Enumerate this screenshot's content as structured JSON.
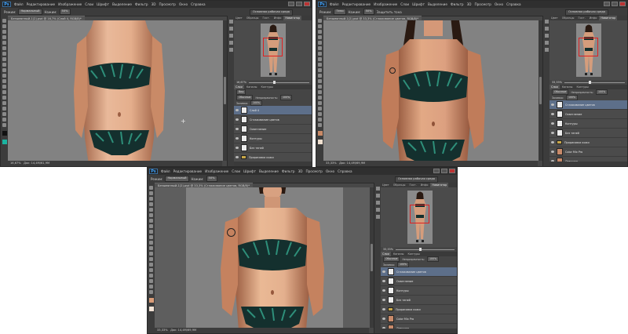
{
  "app_logo": "Ps",
  "menu_items": [
    "Файл",
    "Редактирование",
    "Изображение",
    "Слои",
    "Шрифт",
    "Выделение",
    "Фильтр",
    "3D",
    "Просмотр",
    "Окно",
    "Справка"
  ],
  "options": {
    "mode_label": "Режим:",
    "mode_value": "Нормальный",
    "opacity_label": "Нажим:",
    "opacity_value": "50%",
    "protect_label": "Защитить тона",
    "workspace": "Основная рабочая среда",
    "win2_mode_value": "Тени"
  },
  "windows": [
    {
      "doc_title": "Безымянный-1(2).psd @ 16,7% (Слой 4, RGB/8)*",
      "status": "16,67%",
      "doc_info": "Док: 14,4M/61,9M",
      "layer_mode": "Обычные",
      "opacity_label": "Непрозрачность:",
      "opacity": "100%",
      "fill_label": "Заливка:",
      "fill": "100%",
      "kind_label": "Вид",
      "layers": [
        {
          "name": "Слой 4",
          "type": "layer",
          "selected": true
        },
        {
          "name": "Сглаживание цветов",
          "type": "layer",
          "selected": false
        },
        {
          "name": "Осветление",
          "type": "layer",
          "selected": false
        },
        {
          "name": "Контуры",
          "type": "layer",
          "selected": false
        },
        {
          "name": "Без теней",
          "type": "layer",
          "selected": false
        },
        {
          "name": "Прорисовка кожи",
          "type": "group",
          "selected": false
        },
        {
          "name": "Color Mix Pro",
          "type": "skin",
          "selected": false
        }
      ]
    },
    {
      "doc_title": "Безымянный-1(2).psd @ 33,3% (Сглаживание цветов, RGB/8)*",
      "status": "33,33%",
      "doc_info": "Док: 14,4M/69,9M",
      "layer_mode": "Обычные",
      "opacity_label": "Непрозрачность:",
      "opacity": "100%",
      "fill_label": "Заливка:",
      "fill": "100%",
      "kind_label": "Вид",
      "layers": [
        {
          "name": "Сглаживание цветов",
          "type": "layer",
          "selected": true
        },
        {
          "name": "Осветление",
          "type": "layer",
          "selected": false
        },
        {
          "name": "Контуры",
          "type": "layer",
          "selected": false
        },
        {
          "name": "Без теней",
          "type": "layer",
          "selected": false
        },
        {
          "name": "Прорисовка кожи",
          "type": "group",
          "selected": false
        },
        {
          "name": "Color Mix Pro",
          "type": "skin",
          "selected": false
        },
        {
          "name": "Девушка",
          "type": "skin",
          "selected": false
        }
      ]
    },
    {
      "doc_title": "Безымянный-1(2).psd @ 33,3% (Сглаживание цветов, RGB/8)*",
      "status": "33,33%",
      "doc_info": "Док: 14,4M/69,9M",
      "layer_mode": "Обычные",
      "opacity_label": "Непрозрачность:",
      "opacity": "100%",
      "fill_label": "Заливка:",
      "fill": "100%",
      "kind_label": "Вид",
      "layers": [
        {
          "name": "Сглаживание цветов",
          "type": "layer",
          "selected": true
        },
        {
          "name": "Осветление",
          "type": "layer",
          "selected": false
        },
        {
          "name": "Контуры",
          "type": "layer",
          "selected": false
        },
        {
          "name": "Без теней",
          "type": "layer",
          "selected": false
        },
        {
          "name": "Прорисовка кожи",
          "type": "group",
          "selected": false
        },
        {
          "name": "Color Mix Pro",
          "type": "skin",
          "selected": false
        },
        {
          "name": "Девушка",
          "type": "skin",
          "selected": false
        }
      ]
    }
  ],
  "panel_tabs": [
    "Цвет",
    "Образцы",
    "Гист.",
    "Инфо",
    "Навигатор"
  ],
  "layer_tabs": [
    "Слои",
    "Каналы",
    "Контуры"
  ],
  "colors": {
    "skin_light": "#e9b99a",
    "skin_mid": "#c98a67",
    "skin_dark": "#9c5f43",
    "bikini_base": "#14302e",
    "bikini_accent": "#2e8f7a",
    "selected_layer": "#5d6f8a",
    "canvas_gray": "#828282"
  }
}
